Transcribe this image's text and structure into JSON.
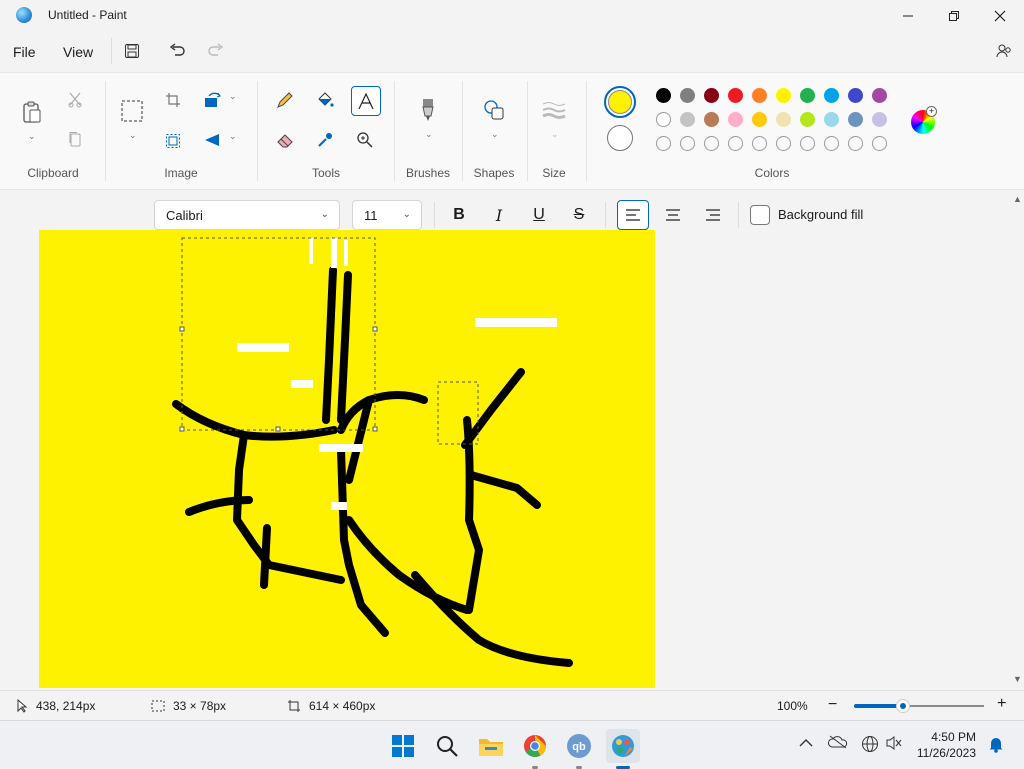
{
  "window": {
    "title": "Untitled - Paint"
  },
  "menu": {
    "file": "File",
    "view": "View"
  },
  "ribbon": {
    "groups": {
      "clipboard": "Clipboard",
      "image": "Image",
      "tools": "Tools",
      "brushes": "Brushes",
      "shapes": "Shapes",
      "size": "Size",
      "colors": "Colors"
    },
    "primary_color": "#fff200",
    "secondary_color": "#ffffff",
    "palette_row1": [
      "#000000",
      "#7f7f7f",
      "#880015",
      "#ed1c24",
      "#ff7f27",
      "#fff200",
      "#22b14c",
      "#00a2e8",
      "#3f48cc",
      "#a349a4"
    ],
    "palette_row2": [
      "#ffffff",
      "#c3c3c3",
      "#b97a57",
      "#ffaec9",
      "#ffc90e",
      "#efe4b0",
      "#b5e61d",
      "#99d9ea",
      "#7092be",
      "#c8bfe7"
    ]
  },
  "text_toolbar": {
    "font": "Calibri",
    "size": "11",
    "background_fill": "Background fill"
  },
  "canvas": {
    "color": "#fff200"
  },
  "status": {
    "cursor": "438, 214px",
    "selection": "33 × 78px",
    "canvas_size": "614 × 460px",
    "zoom": "100%"
  },
  "taskbar": {
    "time": "4:50 PM",
    "date": "11/26/2023"
  }
}
